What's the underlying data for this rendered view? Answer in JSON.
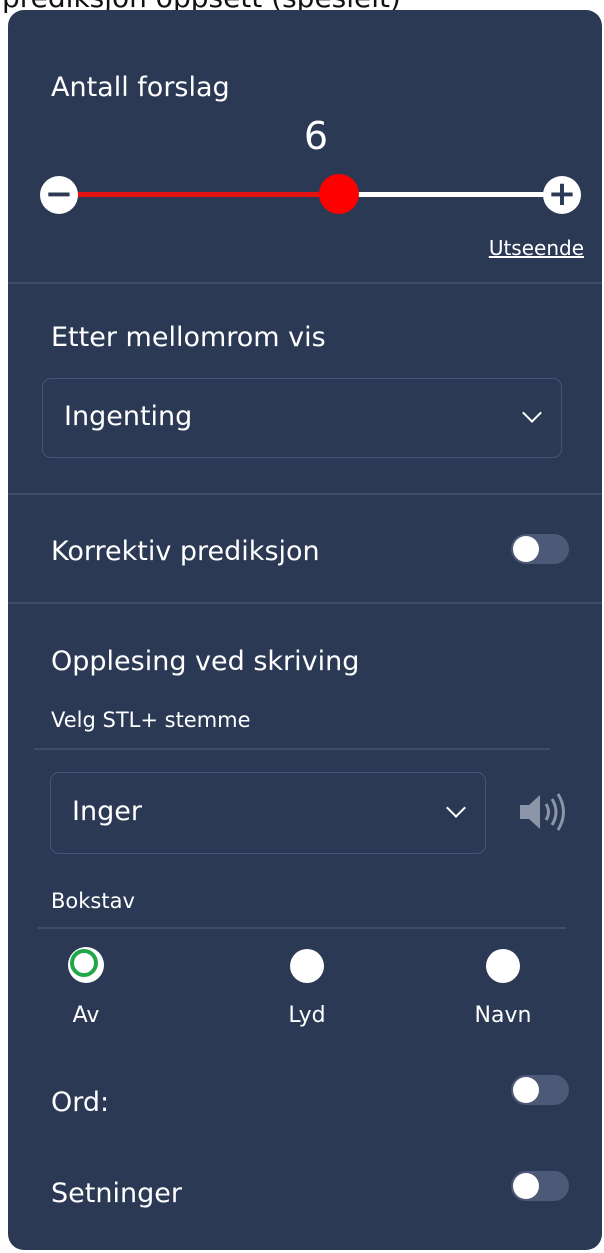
{
  "top_caption": "prediksjon oppsett (spesielt)",
  "suggestions": {
    "title": "Antall forslag",
    "value": "6",
    "level": 0.5,
    "minus_glyph": "−",
    "plus_glyph": "+",
    "appearance_link": "Utseende",
    "track_color": "#e41313",
    "thumb_color": "#ff0000"
  },
  "after_space": {
    "title": "Etter mellomrom vis",
    "selected": "Ingenting"
  },
  "corrective": {
    "label": "Korrektiv prediksjon",
    "enabled": false
  },
  "reading": {
    "title": "Opplesing ved skriving",
    "voice_label": "Velg STL+ stemme",
    "voice_selected": "Inger",
    "speaker_icon": "speaker-icon",
    "letter_label": "Bokstav",
    "letter_options": [
      {
        "label": "Av",
        "checked": true
      },
      {
        "label": "Lyd",
        "checked": false
      },
      {
        "label": "Navn",
        "checked": false
      }
    ],
    "words_label": "Ord:",
    "words_enabled": false,
    "sentences_label": "Setninger",
    "sentences_enabled": false
  },
  "colors": {
    "panel_bg": "#2b3955",
    "accent_green": "#22a64a",
    "toggle_off": "#4c5a77"
  }
}
